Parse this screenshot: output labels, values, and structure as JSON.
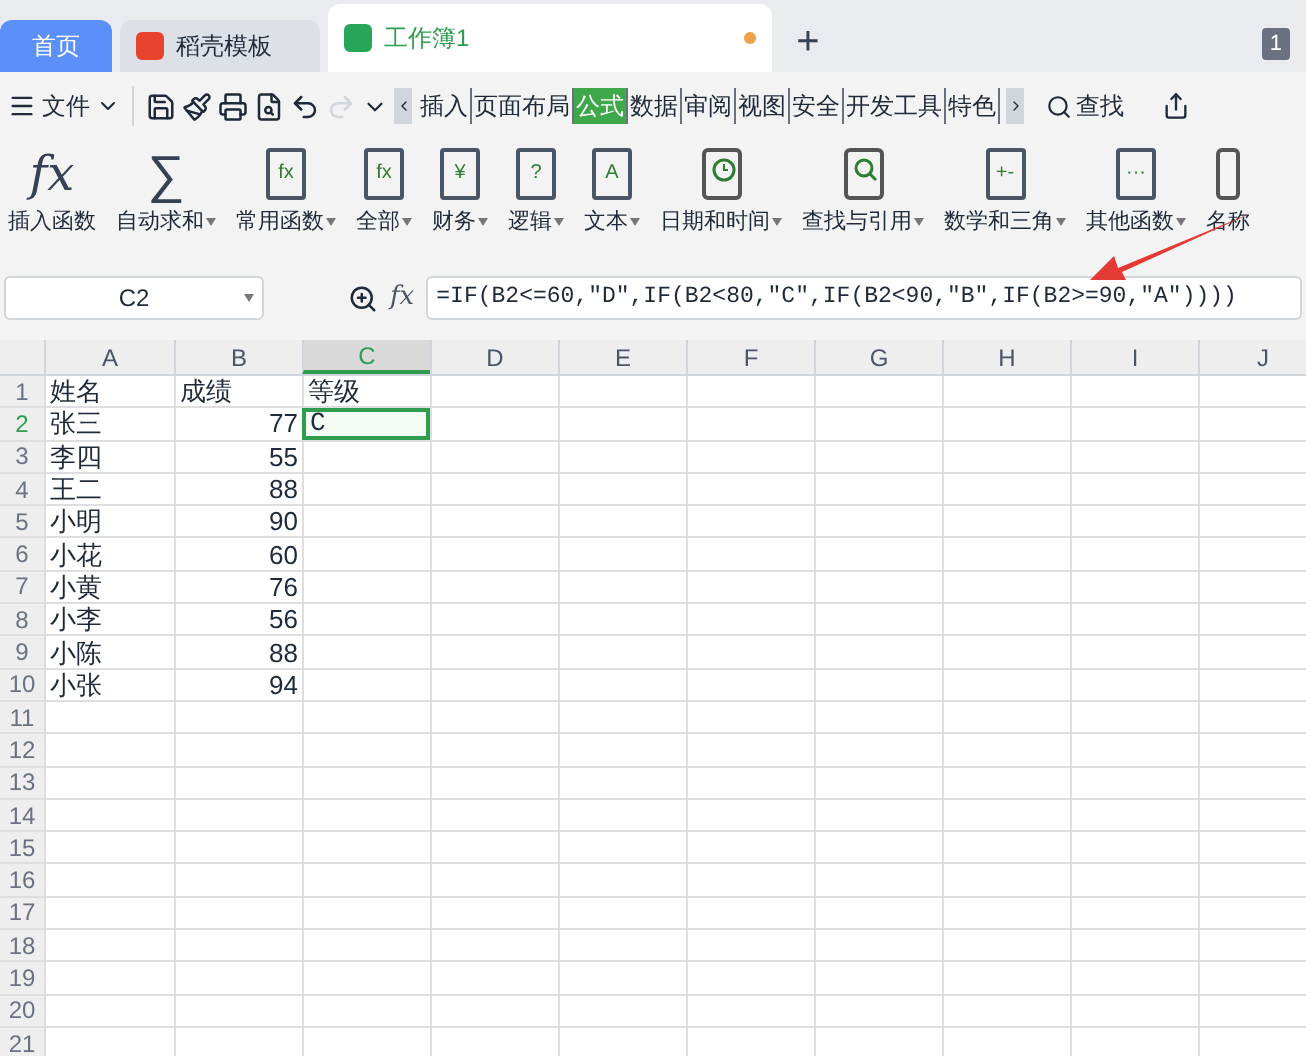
{
  "doc_tabs": [
    {
      "label": "首页",
      "kind": "home",
      "selected": false
    },
    {
      "label": "稻壳模板",
      "kind": "template",
      "selected": false
    },
    {
      "label": "工作簿1",
      "kind": "sheet",
      "selected": true
    }
  ],
  "new_tab": "+",
  "window_count": "1",
  "menu": {
    "file": "文件",
    "ribbon_tabs": [
      {
        "label": "插入",
        "selected": false
      },
      {
        "label": "页面布局",
        "selected": false
      },
      {
        "label": "公式",
        "selected": true
      },
      {
        "label": "数据",
        "selected": false
      },
      {
        "label": "审阅",
        "selected": false
      },
      {
        "label": "视图",
        "selected": false
      },
      {
        "label": "安全",
        "selected": false
      },
      {
        "label": "开发工具",
        "selected": false
      },
      {
        "label": "特色",
        "selected": false
      }
    ],
    "search": "查找"
  },
  "ribbon": [
    {
      "label": "插入函数",
      "kind": "fx",
      "glyph": "fx",
      "dropdown": false
    },
    {
      "label": "自动求和",
      "kind": "sum",
      "glyph": "∑",
      "dropdown": true
    },
    {
      "label": "常用函数",
      "kind": "book",
      "glyph": "fx",
      "dropdown": true
    },
    {
      "label": "全部",
      "kind": "book",
      "glyph": "fx",
      "dropdown": true
    },
    {
      "label": "财务",
      "kind": "book",
      "glyph": "¥",
      "dropdown": true
    },
    {
      "label": "逻辑",
      "kind": "book",
      "glyph": "?",
      "dropdown": true
    },
    {
      "label": "文本",
      "kind": "book",
      "glyph": "A",
      "dropdown": true
    },
    {
      "label": "日期和时间",
      "kind": "clock",
      "dropdown": true
    },
    {
      "label": "查找与引用",
      "kind": "lens",
      "dropdown": true
    },
    {
      "label": "数学和三角",
      "kind": "book",
      "glyph": "+-",
      "dropdown": true
    },
    {
      "label": "其他函数",
      "kind": "book",
      "glyph": "···",
      "dropdown": true
    },
    {
      "label": "名称",
      "kind": "name",
      "dropdown": false
    }
  ],
  "name_box": "C2",
  "fx_label": "fx",
  "formula": "=IF(B2<=60,\"D\",IF(B2<80,\"C\",IF(B2<90,\"B\",IF(B2>=90,\"A\"))))",
  "columns": [
    {
      "label": "A",
      "selected": false
    },
    {
      "label": "B",
      "selected": false
    },
    {
      "label": "C",
      "selected": true
    },
    {
      "label": "D",
      "selected": false
    },
    {
      "label": "E",
      "selected": false
    },
    {
      "label": "F",
      "selected": false
    },
    {
      "label": "G",
      "selected": false
    },
    {
      "label": "H",
      "selected": false
    },
    {
      "label": "I",
      "selected": false
    },
    {
      "label": "J",
      "selected": false
    }
  ],
  "rows": [
    {
      "num": "1",
      "selected": false,
      "cells": [
        {
          "text": "姓名",
          "selected": false
        },
        {
          "text": "成绩",
          "selected": false
        },
        {
          "text": "等级",
          "selected": false
        }
      ]
    },
    {
      "num": "2",
      "selected": true,
      "cells": [
        {
          "text": "张三",
          "selected": false
        },
        {
          "text": "77",
          "selected": false
        },
        {
          "text": "C",
          "selected": true
        }
      ]
    },
    {
      "num": "3",
      "selected": false,
      "cells": [
        {
          "text": "李四",
          "selected": false
        },
        {
          "text": "55",
          "selected": false
        }
      ]
    },
    {
      "num": "4",
      "selected": false,
      "cells": [
        {
          "text": "王二",
          "selected": false
        },
        {
          "text": "88",
          "selected": false
        }
      ]
    },
    {
      "num": "5",
      "selected": false,
      "cells": [
        {
          "text": "小明",
          "selected": false
        },
        {
          "text": "90",
          "selected": false
        }
      ]
    },
    {
      "num": "6",
      "selected": false,
      "cells": [
        {
          "text": "小花",
          "selected": false
        },
        {
          "text": "60",
          "selected": false
        }
      ]
    },
    {
      "num": "7",
      "selected": false,
      "cells": [
        {
          "text": "小黄",
          "selected": false
        },
        {
          "text": "76",
          "selected": false
        }
      ]
    },
    {
      "num": "8",
      "selected": false,
      "cells": [
        {
          "text": "小李",
          "selected": false
        },
        {
          "text": "56",
          "selected": false
        }
      ]
    },
    {
      "num": "9",
      "selected": false,
      "cells": [
        {
          "text": "小陈",
          "selected": false
        },
        {
          "text": "88",
          "selected": false
        }
      ]
    },
    {
      "num": "10",
      "selected": false,
      "cells": [
        {
          "text": "小张",
          "selected": false
        },
        {
          "text": "94",
          "selected": false
        }
      ]
    },
    {
      "num": "11",
      "selected": false,
      "cells": []
    },
    {
      "num": "12",
      "selected": false,
      "cells": []
    },
    {
      "num": "13",
      "selected": false,
      "cells": []
    },
    {
      "num": "14",
      "selected": false,
      "cells": []
    },
    {
      "num": "15",
      "selected": false,
      "cells": []
    },
    {
      "num": "16",
      "selected": false,
      "cells": []
    },
    {
      "num": "17",
      "selected": false,
      "cells": []
    },
    {
      "num": "18",
      "selected": false,
      "cells": []
    },
    {
      "num": "19",
      "selected": false,
      "cells": []
    },
    {
      "num": "20",
      "selected": false,
      "cells": []
    },
    {
      "num": "21",
      "selected": false,
      "cells": []
    }
  ]
}
